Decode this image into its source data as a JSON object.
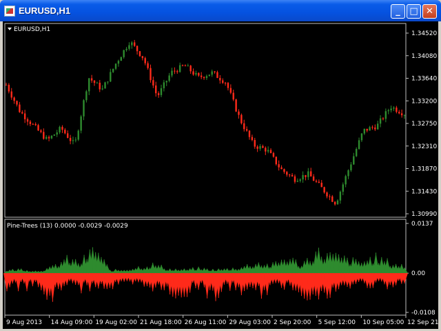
{
  "window": {
    "title": "EURUSD,H1",
    "icon": "chart-window-icon"
  },
  "buttons": {
    "minimize": "_",
    "maximize": "□",
    "close": "✕"
  },
  "main_panel": {
    "label": "EURUSD,H1",
    "y_ticks": [
      "1.34520",
      "1.34080",
      "1.33640",
      "1.33200",
      "1.32750",
      "1.32310",
      "1.31870",
      "1.31430",
      "1.30990"
    ]
  },
  "indicator_panel": {
    "label": "Pine-Trees (13)  0.0000 -0.0029 -0.0029",
    "y_ticks": [
      "0.0137",
      "0.00",
      "-0.0108"
    ]
  },
  "x_axis": {
    "labels": [
      "9 Aug 2013",
      "14 Aug 09:00",
      "19 Aug 02:00",
      "21 Aug 18:00",
      "26 Aug 11:00",
      "29 Aug 03:00",
      "2 Sep 20:00",
      "5 Sep 12:00",
      "10 Sep 05:00",
      "12 Sep 21:00"
    ]
  },
  "colors": {
    "background": "#000000",
    "bull": "#2e8b2e",
    "bear": "#ff2a1a",
    "axis": "#ffffff"
  },
  "chart_data": [
    {
      "type": "line",
      "title": "EURUSD,H1",
      "ylim": [
        1.3088,
        1.3462
      ],
      "categories": [
        "9 Aug 2013",
        "14 Aug 09:00",
        "19 Aug 02:00",
        "21 Aug 18:00",
        "26 Aug 11:00",
        "29 Aug 03:00",
        "2 Sep 20:00",
        "5 Sep 12:00",
        "10 Sep 05:00",
        "12 Sep 21:00"
      ],
      "series": [
        {
          "name": "EURUSD,H1",
          "values": [
            1.3355,
            1.33,
            1.327,
            1.324,
            1.3265,
            1.323,
            1.337,
            1.3345,
            1.34,
            1.3445,
            1.341,
            1.333,
            1.338,
            1.3395,
            1.337,
            1.338,
            1.336,
            1.3285,
            1.323,
            1.322,
            1.318,
            1.316,
            1.317,
            1.314,
            1.311,
            1.3185,
            1.326,
            1.327,
            1.331,
            1.3295
          ]
        }
      ]
    },
    {
      "type": "area",
      "title": "Pine-Trees (13)",
      "ylim": [
        -0.0108,
        0.0137
      ],
      "series": [
        {
          "name": "0.0000",
          "values": [
            0.0008,
            0.0012,
            0.0006,
            0.0015,
            0.004,
            0.003,
            0.007,
            0.0008,
            0.001,
            0.0018,
            0.0025,
            0.0012,
            0.001,
            0.0014,
            0.001,
            0.0012,
            0.0018,
            0.003,
            0.0022,
            0.0045,
            0.0025,
            0.006,
            0.005,
            0.004,
            0.003,
            0.0045,
            0.003,
            0.002
          ]
        },
        {
          "name": "-0.0029",
          "values": [
            -0.0045,
            -0.004,
            -0.0035,
            -0.008,
            -0.0025,
            -0.0045,
            -0.0035,
            -0.004,
            -0.003,
            -0.0035,
            -0.004,
            -0.0055,
            -0.006,
            -0.0035,
            -0.007,
            -0.004,
            -0.005,
            -0.006,
            -0.0045,
            -0.0035,
            -0.005,
            -0.0075,
            -0.006,
            -0.004,
            -0.003,
            -0.0035,
            -0.004,
            -0.0029
          ]
        }
      ]
    }
  ]
}
